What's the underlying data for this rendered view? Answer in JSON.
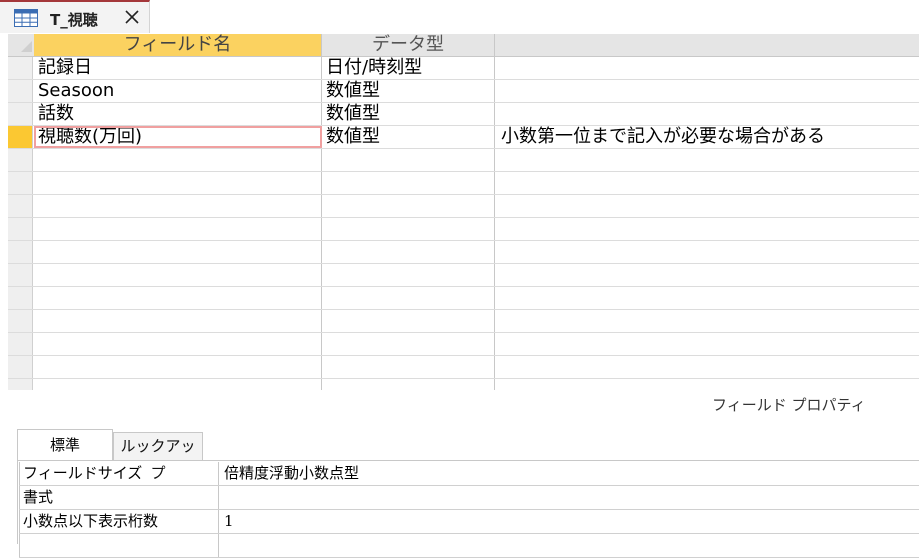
{
  "document_tab": {
    "title": "T_視聴",
    "icon": "table-icon",
    "close_icon": "close-icon"
  },
  "grid": {
    "columns": [
      "フィールド名",
      "データ型",
      ""
    ],
    "rows": [
      {
        "name": "記録日",
        "type": "日付/時刻型",
        "description": ""
      },
      {
        "name": "Seasoon",
        "type": "数値型",
        "description": ""
      },
      {
        "name": "話数",
        "type": "数値型",
        "description": ""
      },
      {
        "name": "視聴数(万回)",
        "type": "数値型",
        "description": "小数第一位まで記入が必要な場合がある"
      }
    ],
    "active_row": 3,
    "empty_rows": 11
  },
  "field_properties": {
    "label": "フィールド プロパティ",
    "tabs": [
      "標準",
      "ルックアップ"
    ],
    "active_tab": 0,
    "rows": [
      {
        "label": "フィールドサイズ",
        "value": "倍精度浮動小数点型"
      },
      {
        "label": "書式",
        "value": ""
      },
      {
        "label": "小数点以下表示桁数",
        "value": "1"
      },
      {
        "label": "",
        "value": ""
      }
    ]
  },
  "colors": {
    "accent_red": "#a4373a",
    "selected_header": "#fbd260",
    "active_row_selector": "#fbc832"
  }
}
